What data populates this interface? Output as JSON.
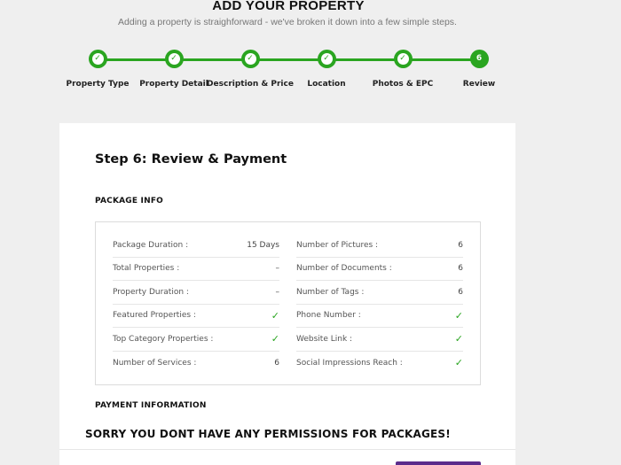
{
  "header": {
    "title": "ADD YOUR PROPERTY",
    "subtitle": "Adding a property is straighforward - we've broken it down into a few simple steps."
  },
  "steps": [
    {
      "label": "Property Type",
      "state": "done"
    },
    {
      "label": "Property Detail",
      "state": "done"
    },
    {
      "label": "Description & Price",
      "state": "done"
    },
    {
      "label": "Location",
      "state": "done"
    },
    {
      "label": "Photos & EPC",
      "state": "done"
    },
    {
      "label": "Review",
      "state": "active",
      "number": "6"
    }
  ],
  "colors": {
    "accent": "#2aa520",
    "button": "#5b2b8c"
  },
  "review": {
    "title": "Step 6: Review & Payment",
    "package_heading": "PACKAGE INFO",
    "payment_heading": "PAYMENT INFORMATION"
  },
  "package_left": [
    {
      "label": "Package Duration :",
      "value": "15 Days"
    },
    {
      "label": "Total Properties :",
      "value": "–"
    },
    {
      "label": "Property Duration :",
      "value": "–"
    },
    {
      "label": "Featured Properties :",
      "value": "✓"
    },
    {
      "label": "Top Category Properties :",
      "value": "✓"
    },
    {
      "label": "Number of Services :",
      "value": "6"
    }
  ],
  "package_right": [
    {
      "label": "Number of Pictures :",
      "value": "6"
    },
    {
      "label": "Number of Documents :",
      "value": "6"
    },
    {
      "label": "Number of Tags :",
      "value": "6"
    },
    {
      "label": "Phone Number :",
      "value": "✓"
    },
    {
      "label": "Website Link :",
      "value": "✓"
    },
    {
      "label": "Social Impressions Reach :",
      "value": "✓"
    }
  ],
  "message": "SORRY YOU DONT HAVE ANY PERMISSIONS FOR PACKAGES!"
}
